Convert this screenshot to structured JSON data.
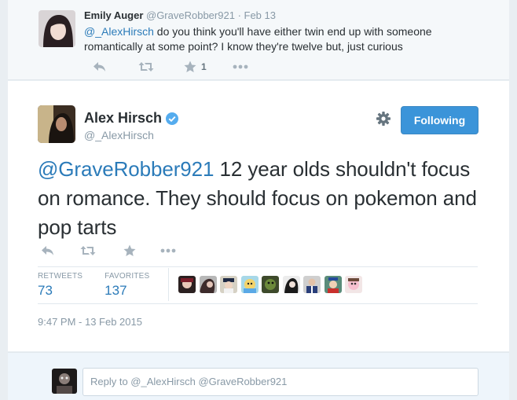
{
  "parent_tweet": {
    "fullname": "Emily Auger",
    "username": "@GraveRobber921",
    "date": "Feb 13",
    "mention": "@_AlexHirsch",
    "text": " do you think you'll have either twin end up with someone romantically at some point? I know they're twelve but, just curious",
    "favorite_count": "1",
    "icons": [
      "reply-icon",
      "retweet-icon",
      "star-icon",
      "more-icon"
    ]
  },
  "main_tweet": {
    "fullname": "Alex Hirsch",
    "username": "@_AlexHirsch",
    "follow_label": "Following",
    "mention": "@GraveRobber921",
    "text": " 12 year olds shouldn't focus on romance. They should focus on pokemon and pop tarts",
    "stats": {
      "retweets_label": "RETWEETS",
      "retweets_value": "73",
      "favorites_label": "FAVORITES",
      "favorites_value": "137"
    },
    "favoriter_count_shown": 9,
    "timestamp": "9:47 PM - 13 Feb 2015"
  },
  "reply_box": {
    "placeholder": "Reply to @_AlexHirsch @GraveRobber921"
  },
  "colors": {
    "link": "#2b7bb9",
    "follow_button": "#3b94d9",
    "verified": "#55acee",
    "action_icon": "#a7b3bd"
  }
}
